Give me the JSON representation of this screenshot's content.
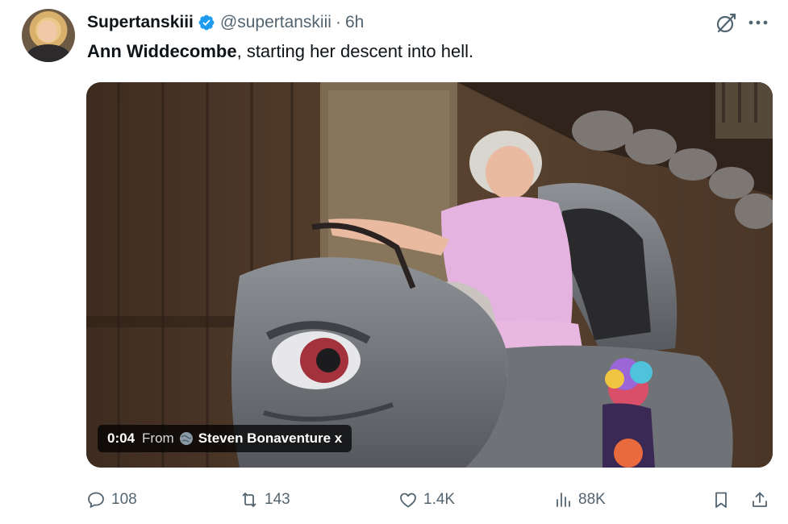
{
  "author": {
    "display_name": "Supertanskiii",
    "handle": "@supertanskiii",
    "separator": "·",
    "time": "6h"
  },
  "tweet": {
    "bold_text": "Ann Widdecombe",
    "rest_text": ", starting her descent into hell."
  },
  "video": {
    "timestamp": "0:04",
    "from_label": "From",
    "source_name": "Steven Bonaventure x"
  },
  "actions": {
    "replies": "108",
    "reposts": "143",
    "likes": "1.4K",
    "views": "88K"
  },
  "icons": {
    "verified": "verified-badge-icon",
    "grok": "grok-icon",
    "more": "more-icon",
    "reply": "reply-icon",
    "repost": "repost-icon",
    "like": "heart-icon",
    "views": "views-icon",
    "bookmark": "bookmark-icon",
    "share": "share-icon"
  },
  "colors": {
    "verified_blue": "#1d9bf0",
    "text_primary": "#0f1419",
    "text_secondary": "#536471"
  }
}
